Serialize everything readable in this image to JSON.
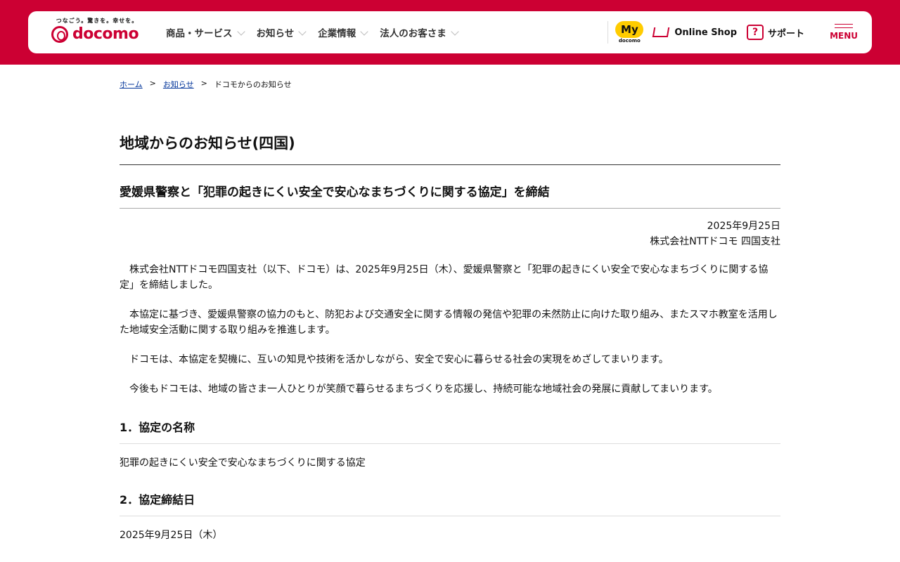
{
  "header": {
    "tagline": "つなごう。驚きを。幸せを。",
    "brand": "docomo",
    "nav": [
      "商品・サービス",
      "お知らせ",
      "企業情報",
      "法人のお客さま"
    ],
    "my": "My",
    "my_sub": "docomo",
    "shop": "Online Shop",
    "support": "サポート",
    "support_icon": "?",
    "menu": "MENU"
  },
  "breadcrumb": [
    "ホーム",
    "お知らせ",
    "ドコモからのお知らせ"
  ],
  "page_title": "地域からのお知らせ(四国)",
  "article": {
    "title": "愛媛県警察と「犯罪の起きにくい安全で安心なまちづくりに関する協定」を締結",
    "date": "2025年9月25日",
    "org": "株式会社NTTドコモ 四国支社",
    "paragraphs": [
      "株式会社NTTドコモ四国支社（以下、ドコモ）は、2025年9月25日（木）、愛媛県警察と「犯罪の起きにくい安全で安心なまちづくりに関する協定」を締結しました。",
      "本協定に基づき、愛媛県警察の協力のもと、防犯および交通安全に関する情報の発信や犯罪の未然防止に向けた取り組み、またスマホ教室を活用した地域安全活動に関する取り組みを推進します。",
      "ドコモは、本協定を契機に、互いの知見や技術を活かしながら、安全で安心に暮らせる社会の実現をめざしてまいります。",
      "今後もドコモは、地域の皆さま一人ひとりが笑顔で暮らせるまちづくりを応援し、持続可能な地域社会の発展に貢献してまいります。"
    ],
    "sections": [
      {
        "heading": "1．協定の名称",
        "value": "犯罪の起きにくい安全で安心なまちづくりに関する協定"
      },
      {
        "heading": "2．協定締結日",
        "value": "2025年9月25日（木）"
      }
    ]
  }
}
